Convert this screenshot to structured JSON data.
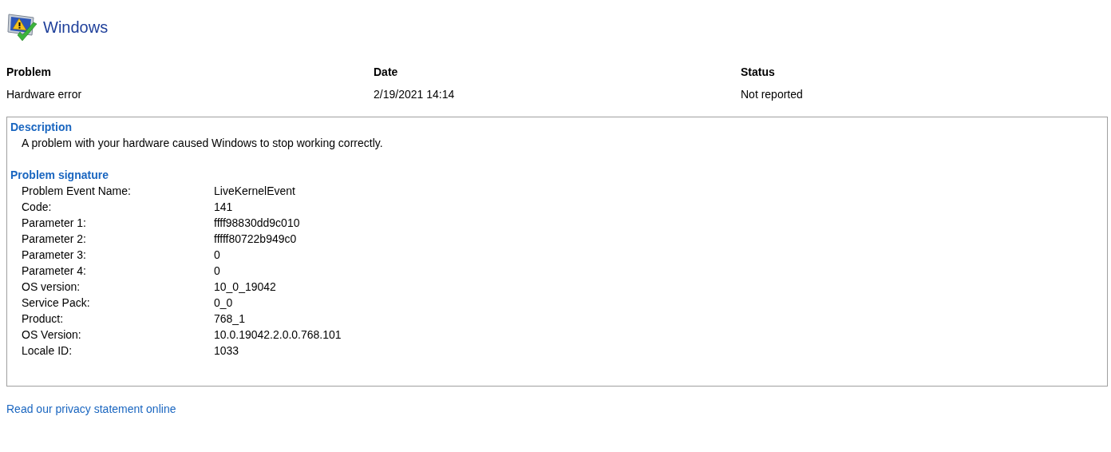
{
  "header": {
    "title": "Windows"
  },
  "summary": [
    {
      "heading": "Problem",
      "value": "Hardware error"
    },
    {
      "heading": "Date",
      "value": "2/19/2021 14:14"
    },
    {
      "heading": "Status",
      "value": "Not reported"
    }
  ],
  "description": {
    "heading": "Description",
    "text": "A problem with your hardware caused Windows to stop working correctly."
  },
  "signature": {
    "heading": "Problem signature",
    "rows": [
      {
        "label": "Problem Event Name:",
        "value": "LiveKernelEvent"
      },
      {
        "label": "Code:",
        "value": "141"
      },
      {
        "label": "Parameter 1:",
        "value": "ffff98830dd9c010"
      },
      {
        "label": "Parameter 2:",
        "value": "fffff80722b949c0"
      },
      {
        "label": "Parameter 3:",
        "value": "0"
      },
      {
        "label": "Parameter 4:",
        "value": "0"
      },
      {
        "label": "OS version:",
        "value": "10_0_19042"
      },
      {
        "label": "Service Pack:",
        "value": "0_0"
      },
      {
        "label": "Product:",
        "value": "768_1"
      },
      {
        "label": "OS Version:",
        "value": "10.0.19042.2.0.0.768.101"
      },
      {
        "label": "Locale ID:",
        "value": "1033"
      }
    ]
  },
  "link": "Read our privacy statement online"
}
